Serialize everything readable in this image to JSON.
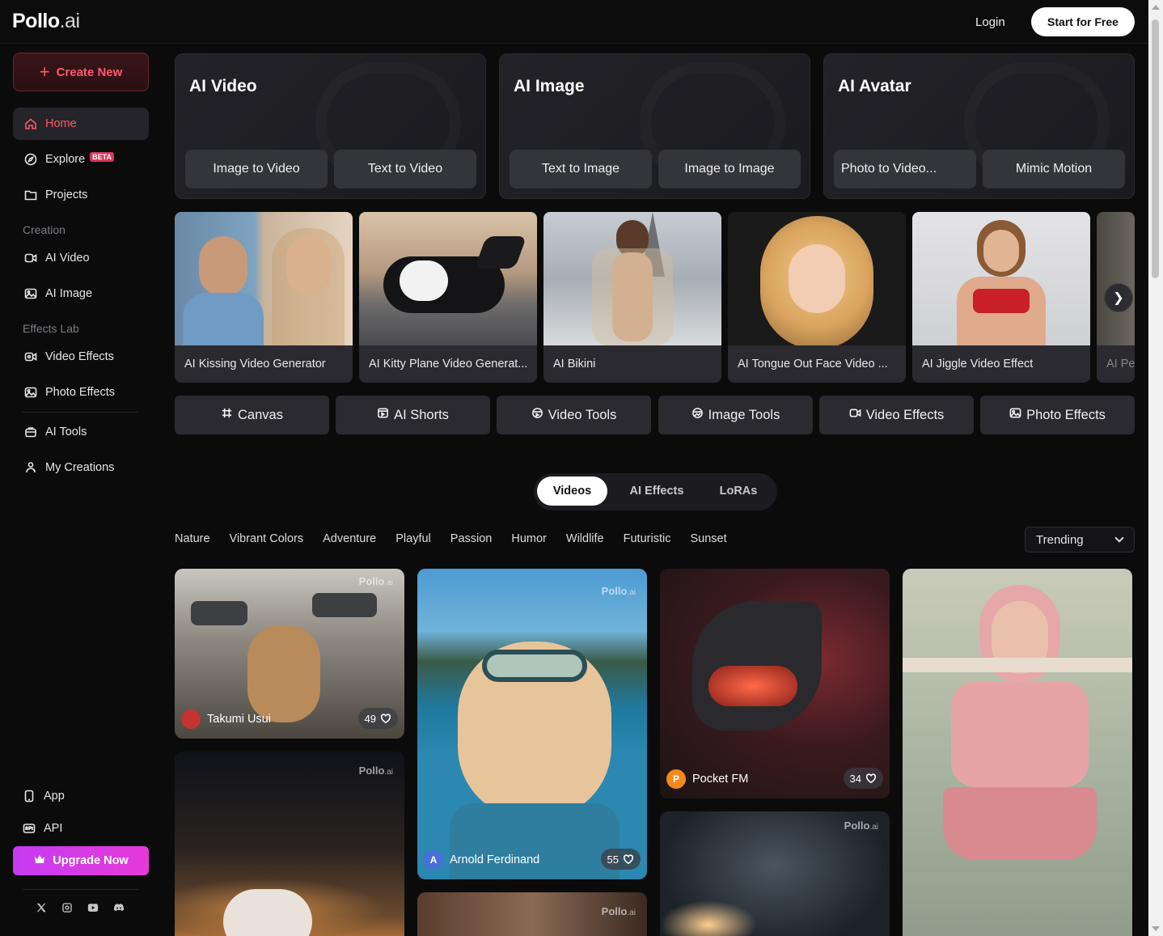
{
  "header": {
    "logo_main": "Pollo",
    "logo_suffix": ".ai",
    "login_label": "Login",
    "start_label": "Start for Free"
  },
  "sidebar": {
    "create_label": "Create New",
    "items_top": [
      {
        "label": "Home",
        "icon": "home-icon"
      },
      {
        "label": "Explore",
        "icon": "compass-icon",
        "badge": "BETA"
      },
      {
        "label": "Projects",
        "icon": "folder-icon"
      }
    ],
    "creation_label": "Creation",
    "creation_items": [
      {
        "label": "AI Video",
        "icon": "video-icon"
      },
      {
        "label": "AI Image",
        "icon": "image-icon"
      }
    ],
    "effects_label": "Effects Lab",
    "effects_items": [
      {
        "label": "Video Effects",
        "icon": "video-effects-icon"
      },
      {
        "label": "Photo Effects",
        "icon": "photo-effects-icon"
      }
    ],
    "tools_items": [
      {
        "label": "AI Tools",
        "icon": "toolbox-icon"
      },
      {
        "label": "My Creations",
        "icon": "user-creations-icon"
      }
    ],
    "bottom_items": [
      {
        "label": "App",
        "icon": "phone-icon"
      },
      {
        "label": "API",
        "icon": "api-icon"
      }
    ],
    "upgrade_label": "Upgrade Now"
  },
  "categories": [
    {
      "title": "AI Video",
      "buttons": [
        "Image to Video",
        "Text to Video"
      ]
    },
    {
      "title": "AI Image",
      "buttons": [
        "Text to Image",
        "Image to Image"
      ]
    },
    {
      "title": "AI Avatar",
      "buttons": [
        "Photo to Video...",
        "Mimic Motion"
      ]
    }
  ],
  "featured": [
    "AI Kissing Video Generator",
    "AI Kitty Plane Video Generat...",
    "AI Bikini",
    "AI Tongue Out Face Video ...",
    "AI Jiggle Video Effect",
    "AI Pe"
  ],
  "tools": [
    "Canvas",
    "AI Shorts",
    "Video Tools",
    "Image Tools",
    "Video Effects",
    "Photo Effects"
  ],
  "tabs": [
    "Videos",
    "AI Effects",
    "LoRAs"
  ],
  "filters": [
    "Nature",
    "Vibrant Colors",
    "Adventure",
    "Playful",
    "Passion",
    "Humor",
    "Wildlife",
    "Futuristic",
    "Sunset"
  ],
  "sort_value": "Trending",
  "gallery": [
    {
      "author": "Takumi Usui",
      "likes": "49",
      "watermark": "Pollo",
      "avatar": ""
    },
    {
      "author": "Arnold Ferdinand",
      "likes": "55",
      "watermark": "Pollo",
      "avatar": "A"
    },
    {
      "author": "Pocket FM",
      "likes": "34",
      "watermark": "",
      "avatar": "P"
    },
    {
      "author": "",
      "likes": "",
      "watermark": "Pollo",
      "avatar": ""
    },
    {
      "author": "",
      "likes": "",
      "watermark": "Pollo",
      "avatar": ""
    },
    {
      "author": "",
      "likes": "",
      "watermark": "Pollo",
      "avatar": ""
    }
  ],
  "colors": {
    "accent": "#ff5a6a",
    "upgrade": "#d43ae6",
    "background": "#0b0b0c"
  }
}
